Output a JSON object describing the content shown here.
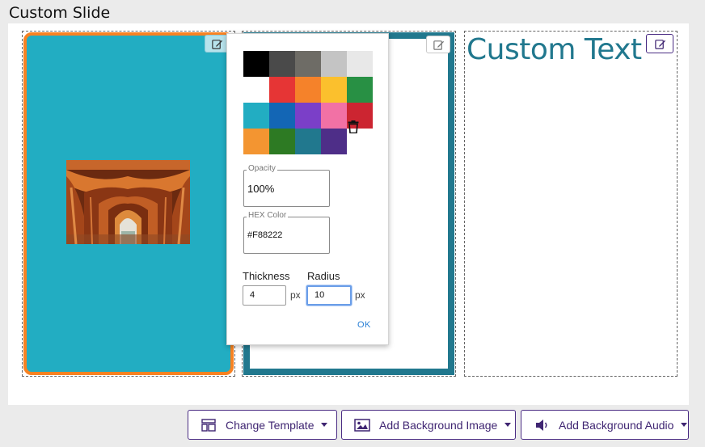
{
  "page": {
    "title": "Custom Slide"
  },
  "slide": {
    "custom_text": "Custom Text",
    "image_panel": {
      "background": "#22adc2",
      "border_color": "#F88222"
    },
    "frame_panel": {
      "border_color": "#21788e"
    }
  },
  "style_popover": {
    "swatches": [
      "#000000",
      "#4a4a4a",
      "#6e6c66",
      "#c4c4c4",
      "#e8e8e8",
      "#ffffff",
      "#e63535",
      "#f5822a",
      "#fbc02d",
      "#289044",
      "#22adc2",
      "#1366b5",
      "#7b3fc8",
      "#f271a5",
      "#cc2531",
      "#f39531",
      "#2d7a23",
      "#21788e",
      "#4e2e88"
    ],
    "opacity": {
      "label": "Opacity",
      "value": "100%"
    },
    "hex": {
      "label": "HEX Color",
      "value": "#F88222"
    },
    "thickness": {
      "label": "Thickness",
      "value": "4",
      "unit": "px"
    },
    "radius": {
      "label": "Radius",
      "value": "10",
      "unit": "px"
    },
    "ok_label": "OK"
  },
  "toolbar": {
    "change_template": "Change Template",
    "add_background_image": "Add Background Image",
    "add_background_audio": "Add Background Audio"
  },
  "icons": {
    "edit": "edit-icon",
    "trash": "trash-icon",
    "template": "layout-icon",
    "image": "image-icon",
    "audio": "volume-icon"
  }
}
